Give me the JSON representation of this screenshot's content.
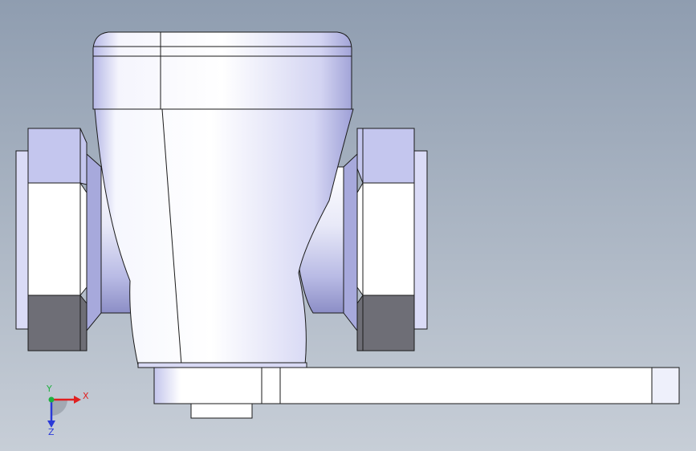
{
  "scene": {
    "background_top": "#8f9db0",
    "background_bottom": "#c7ced7",
    "body_light": "#f4f5fc",
    "body_mid": "#c9cbef",
    "body_dark": "#8e90c8",
    "nut_top": "#c4c6ee",
    "nut_front": "#ffffff",
    "nut_bottom": "#6e6e76",
    "edge": "#1a1a1a"
  },
  "triad": {
    "x_label": "X",
    "y_label": "Y",
    "z_label": "Z",
    "x_color": "#e02020",
    "y_color": "#20b040",
    "z_color": "#2a3ad8"
  }
}
